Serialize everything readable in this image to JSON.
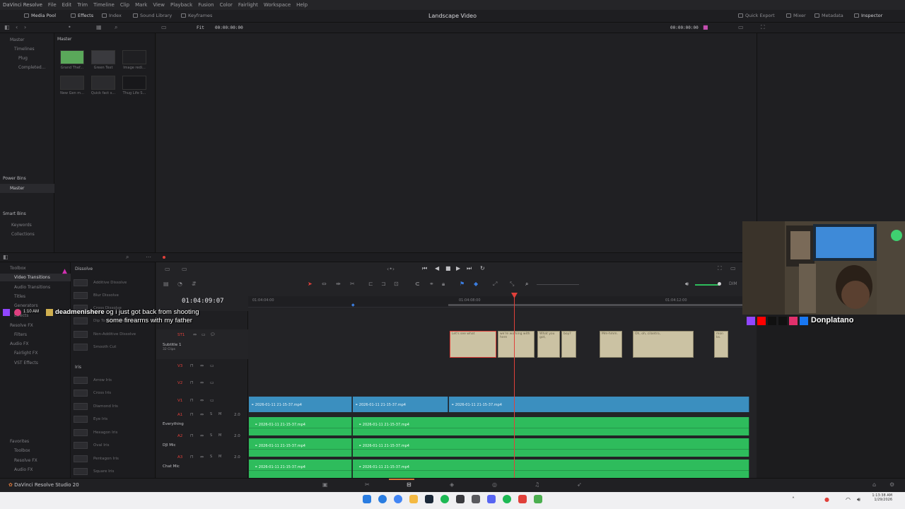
{
  "app": {
    "name": "DaVinci Resolve",
    "menu": [
      "File",
      "Edit",
      "Trim",
      "Timeline",
      "Clip",
      "Mark",
      "View",
      "Playback",
      "Fusion",
      "Color",
      "Fairlight",
      "Workspace",
      "Help"
    ],
    "project_title": "Landscape Video",
    "brand_label": "DaVinci Resolve Studio 20"
  },
  "toolbar": {
    "media_pool": "Media Pool",
    "effects": "Effects",
    "index": "Index",
    "sound_library": "Sound Library",
    "keyframes": "Keyframes",
    "quick_export": "Quick Export",
    "mixer": "Mixer",
    "metadata": "Metadata",
    "inspector": "Inspector"
  },
  "viewer_bar": {
    "fit": "Fit",
    "timecode_left": "00:00:00:00",
    "timecode_right": "00:00:00:00"
  },
  "media_pool": {
    "master_label": "Master",
    "tree": [
      "Master",
      "Timelines",
      "Plug",
      "Completed..."
    ],
    "clips": [
      {
        "name": "Grand Thef...",
        "color": "#5aa85a"
      },
      {
        "name": "Green Text",
        "color": "#3a3a3e"
      },
      {
        "name": "Image redi...",
        "color": "#2a2a2e"
      },
      {
        "name": "New Gen m...",
        "color": "#2a2a2e"
      },
      {
        "name": "Quick fact s...",
        "color": "#2a2a2e"
      },
      {
        "name": "Thug Life S...",
        "color": "#222226"
      }
    ]
  },
  "bins": {
    "power_bins": "Power Bins",
    "power_master": "Master",
    "smart_bins": "Smart Bins",
    "keywords": "Keywords",
    "collections": "Collections"
  },
  "effects_tree": {
    "toolbox": "Toolbox",
    "video_transitions": "Video Transitions",
    "audio_transitions": "Audio Transitions",
    "titles": "Titles",
    "generators": "Generators",
    "effects": "Effects",
    "resolve_fx": "Resolve FX",
    "filters": "Filters",
    "audio_fx": "Audio FX",
    "fairlight_fx": "Fairlight FX",
    "vst_effects": "VST Effects",
    "favorites": "Favorites",
    "fav_toolbox": "Toolbox",
    "fav_resolve_fx": "Resolve FX",
    "fav_audio_fx": "Audio FX"
  },
  "effects_list": {
    "dissolve_header": "Dissolve",
    "dissolve": [
      "Additive Dissolve",
      "Blur Dissolve",
      "Cross Dissolve",
      "Dip To Color Dissolve",
      "Non-Additive Dissolve",
      "Smooth Cut"
    ],
    "iris_header": "Iris",
    "iris": [
      "Arrow Iris",
      "Cross Iris",
      "Diamond Iris",
      "Eye Iris",
      "Hexagon Iris",
      "Oval Iris",
      "Pentagon Iris",
      "Square Iris"
    ]
  },
  "timeline": {
    "timecode": "01:04:09:07",
    "ruler": [
      "01:04:04:00",
      "01:04:08:00",
      "01:04:12:00"
    ],
    "tracks": {
      "st1": "ST1",
      "st1_name": "Subtitle 1",
      "st1_count": "32 Clips",
      "v3": "V3",
      "v2": "V2",
      "v1": "V1",
      "a1": "A1",
      "a1_name": "Everything",
      "a2": "A2",
      "a2_name": "DJI Mic",
      "a3": "A3",
      "a3_name": "Chat Mic",
      "level": "2.0"
    },
    "subtitles": [
      {
        "text": "Let's see what",
        "start": 636,
        "end": 702,
        "selected": true
      },
      {
        "text": "we're working with here",
        "start": 704,
        "end": 756,
        "selected": false
      },
      {
        "text": "What you got,",
        "start": 760,
        "end": 792,
        "selected": false
      },
      {
        "text": "boy?",
        "start": 794,
        "end": 815,
        "selected": false
      },
      {
        "text": "Mm-hmm.",
        "start": 848,
        "end": 880,
        "selected": false
      },
      {
        "text": "Oh, oh, cilantro,",
        "start": 895,
        "end": 981,
        "selected": false
      },
      {
        "text": "mon ks.",
        "start": 1010,
        "end": 1030,
        "selected": false
      }
    ],
    "video_clips": [
      {
        "name": "2026-01-11 21-15-37.mp4",
        "start": 352,
        "end": 498
      },
      {
        "name": "2026-01-11 21-15-37.mp4",
        "start": 499,
        "end": 634
      },
      {
        "name": "2026-01-11 21-15-37.mp4",
        "start": 635,
        "end": 1060
      }
    ],
    "audio_clips": {
      "a1": [
        {
          "name": "2026-01-11 21-15-37.mp4",
          "start": 352,
          "end": 498
        },
        {
          "name": "2026-01-11 21-15-37.mp4",
          "start": 499,
          "end": 1060
        }
      ],
      "a2": [
        {
          "name": "2026-01-11 21-15-37.mp4",
          "start": 352,
          "end": 498
        },
        {
          "name": "2026-01-11 21-15-37.mp4",
          "start": 499,
          "end": 1060
        }
      ],
      "a3": [
        {
          "name": "2026-01-11 21-15-37.mp4",
          "start": 352,
          "end": 498
        },
        {
          "name": "2026-01-11 21-15-37.mp4",
          "start": 499,
          "end": 1060
        }
      ]
    },
    "dim_label": "DIM"
  },
  "chat_overlay": {
    "time": "1:10 AM",
    "user": "deadmenishere",
    "message_line1": "og i just got back from shooting",
    "message_line2": "some firearms with my father"
  },
  "social": {
    "handle": "Donplatano"
  },
  "taskbar": {
    "time": "1:13:38 AM",
    "date": "1/29/2026"
  },
  "colors": {
    "subtitle_clip": "#cbc2a3",
    "video_clip": "#3b8fbf",
    "audio_clip": "#2ebc5c",
    "playhead": "#e0403a",
    "accent_orange": "#d8763a"
  }
}
